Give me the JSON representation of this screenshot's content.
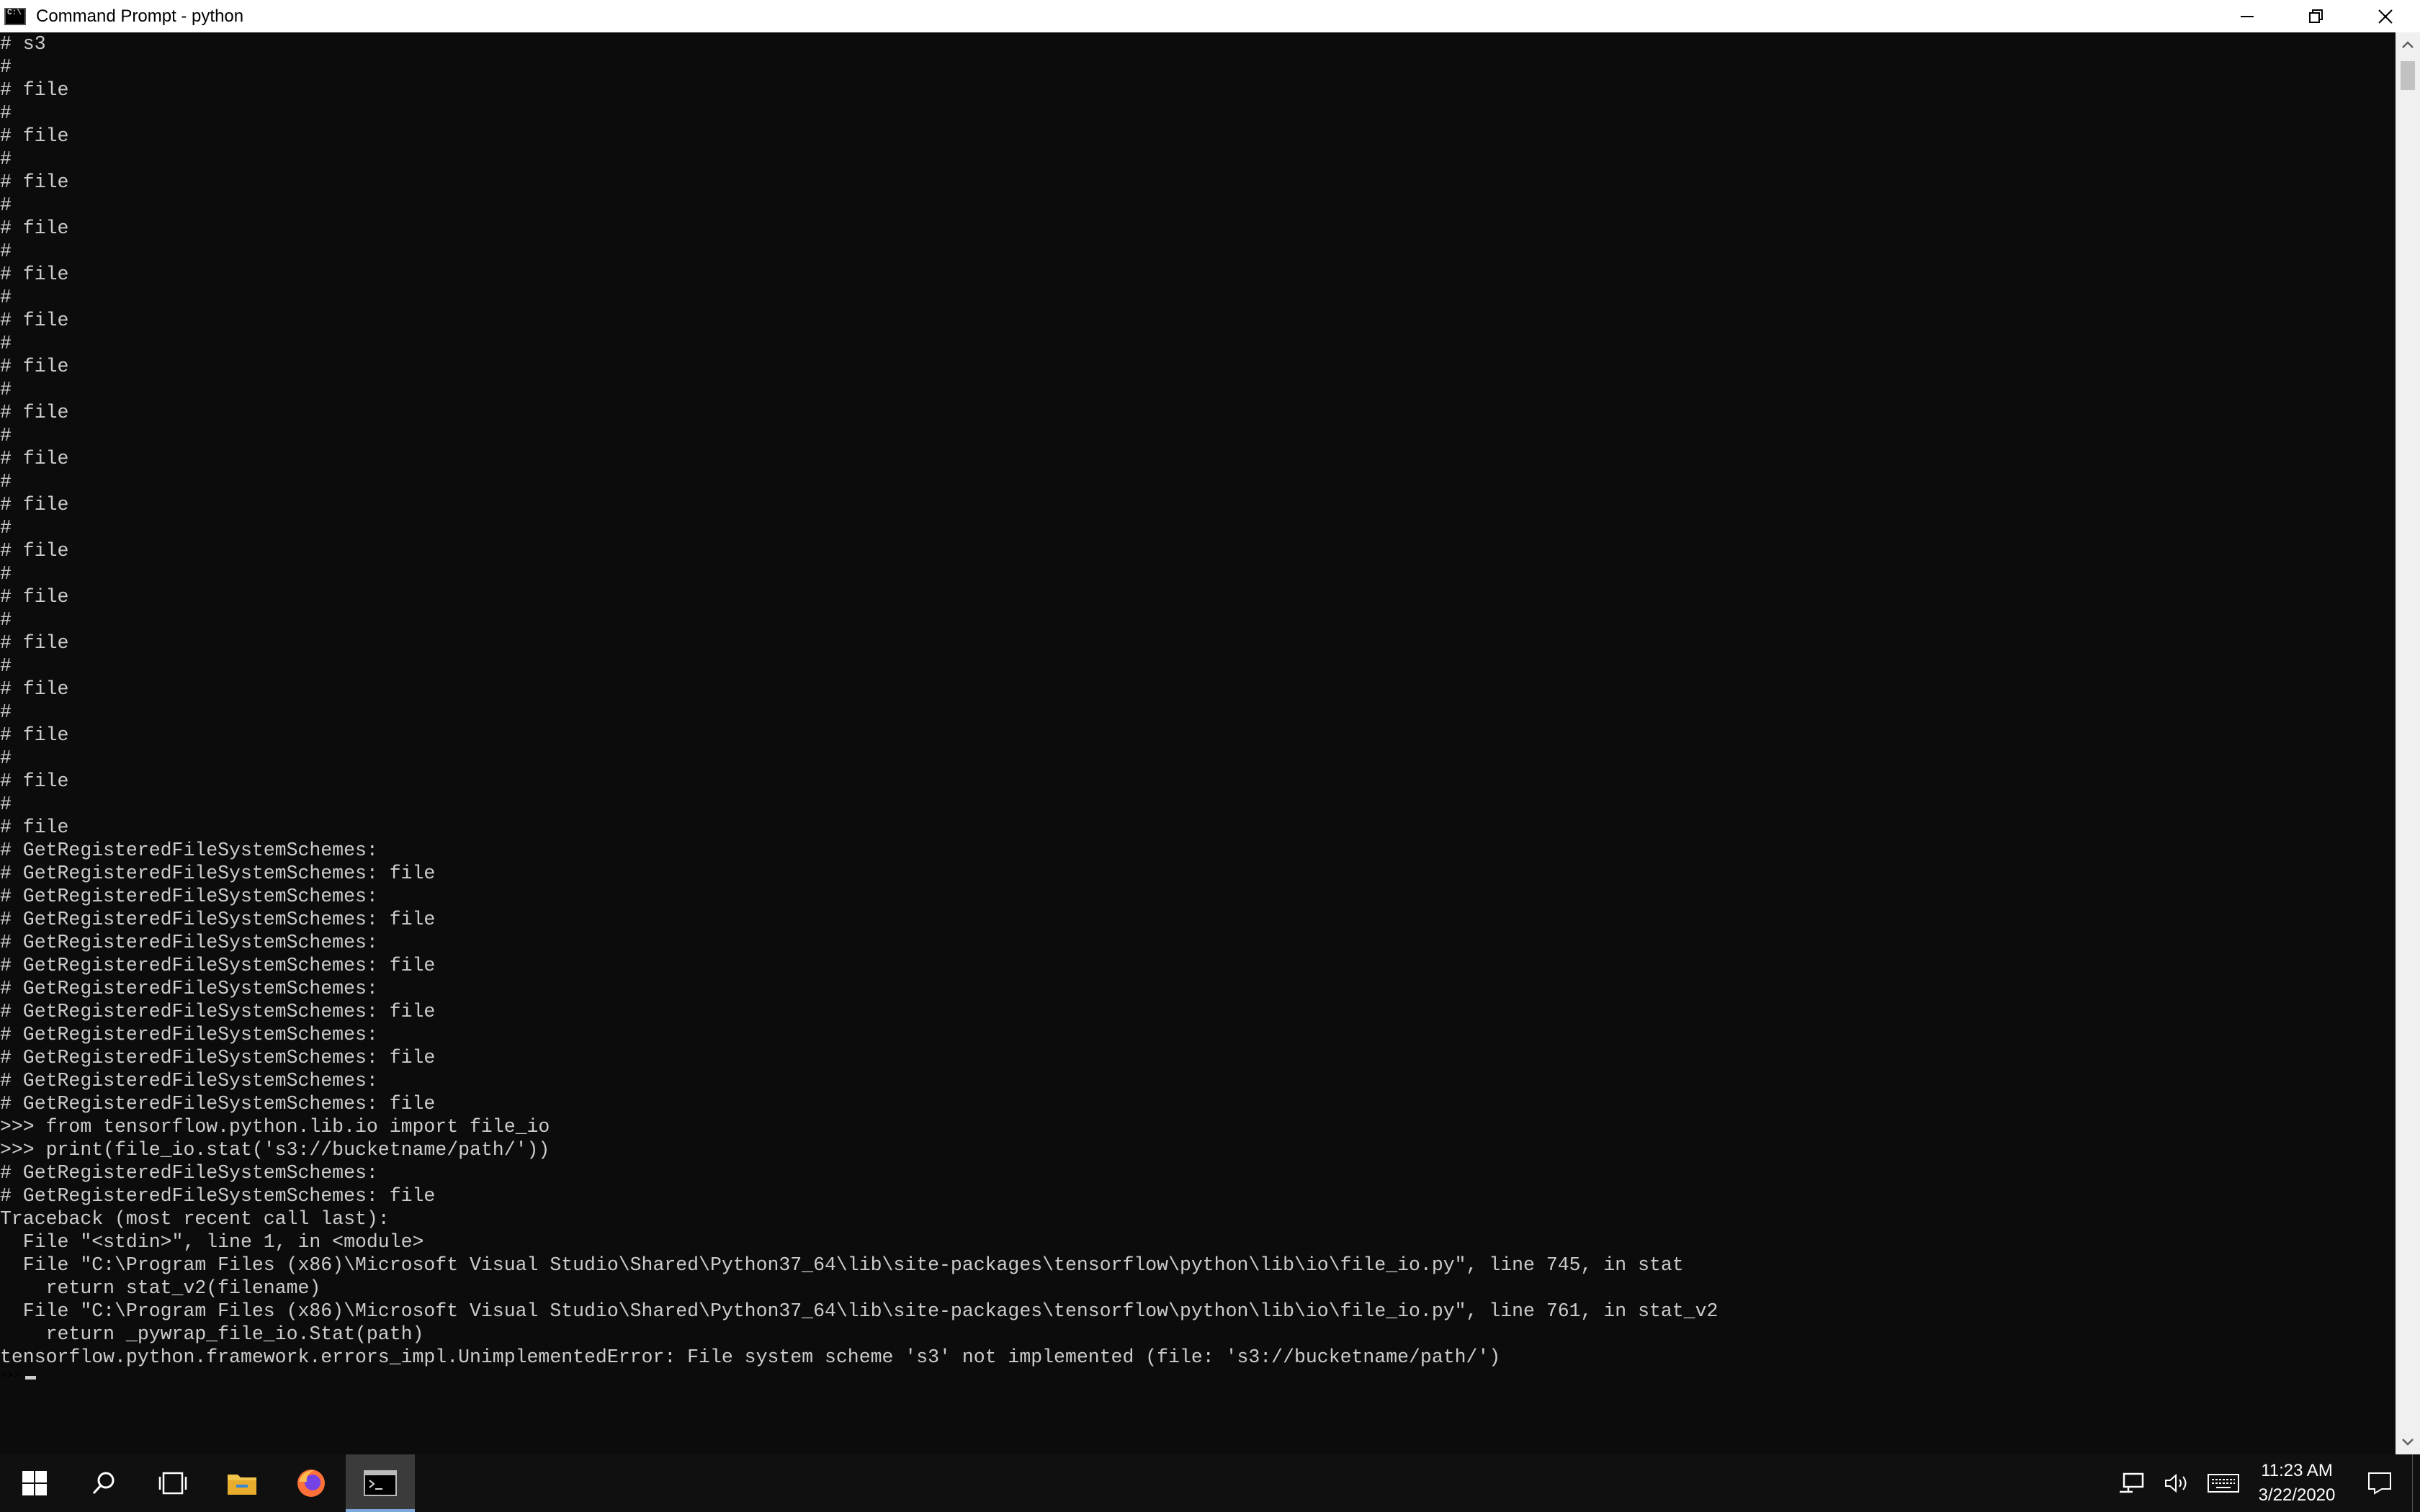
{
  "window": {
    "title": "Command Prompt - python"
  },
  "console": {
    "lines": [
      "# s3",
      "#",
      "# file",
      "#",
      "# file",
      "#",
      "# file",
      "#",
      "# file",
      "#",
      "# file",
      "#",
      "# file",
      "#",
      "# file",
      "#",
      "# file",
      "#",
      "# file",
      "#",
      "# file",
      "#",
      "# file",
      "#",
      "# file",
      "#",
      "# file",
      "#",
      "# file",
      "#",
      "# file",
      "#",
      "# file",
      "#",
      "# file",
      "# GetRegisteredFileSystemSchemes:",
      "# GetRegisteredFileSystemSchemes: file",
      "# GetRegisteredFileSystemSchemes:",
      "# GetRegisteredFileSystemSchemes: file",
      "# GetRegisteredFileSystemSchemes:",
      "# GetRegisteredFileSystemSchemes: file",
      "# GetRegisteredFileSystemSchemes:",
      "# GetRegisteredFileSystemSchemes: file",
      "# GetRegisteredFileSystemSchemes:",
      "# GetRegisteredFileSystemSchemes: file",
      "# GetRegisteredFileSystemSchemes:",
      "# GetRegisteredFileSystemSchemes: file",
      ">>> from tensorflow.python.lib.io import file_io",
      ">>> print(file_io.stat('s3://bucketname/path/'))",
      "# GetRegisteredFileSystemSchemes:",
      "# GetRegisteredFileSystemSchemes: file",
      "Traceback (most recent call last):",
      "  File \"<stdin>\", line 1, in <module>",
      "  File \"C:\\Program Files (x86)\\Microsoft Visual Studio\\Shared\\Python37_64\\lib\\site-packages\\tensorflow\\python\\lib\\io\\file_io.py\", line 745, in stat",
      "    return stat_v2(filename)",
      "  File \"C:\\Program Files (x86)\\Microsoft Visual Studio\\Shared\\Python37_64\\lib\\site-packages\\tensorflow\\python\\lib\\io\\file_io.py\", line 761, in stat_v2",
      "    return _pywrap_file_io.Stat(path)",
      "tensorflow.python.framework.errors_impl.UnimplementedError: File system scheme 's3' not implemented (file: 's3://bucketname/path/')"
    ],
    "prompt": ">>> "
  },
  "taskbar": {
    "items": [
      {
        "name": "start-button",
        "icon": "windows-logo-icon"
      },
      {
        "name": "search-button",
        "icon": "search-icon"
      },
      {
        "name": "task-view-button",
        "icon": "task-view-icon"
      },
      {
        "name": "file-explorer-button",
        "icon": "folder-icon"
      },
      {
        "name": "firefox-button",
        "icon": "firefox-icon"
      },
      {
        "name": "command-prompt-button",
        "icon": "terminal-icon"
      }
    ],
    "clock": {
      "time": "11:23 AM",
      "date": "3/22/2020"
    }
  },
  "colors": {
    "console_bg": "#0c0c0c",
    "console_text": "#cccccc",
    "taskbar_bg": "#101010",
    "accent": "#7aa8d8"
  }
}
